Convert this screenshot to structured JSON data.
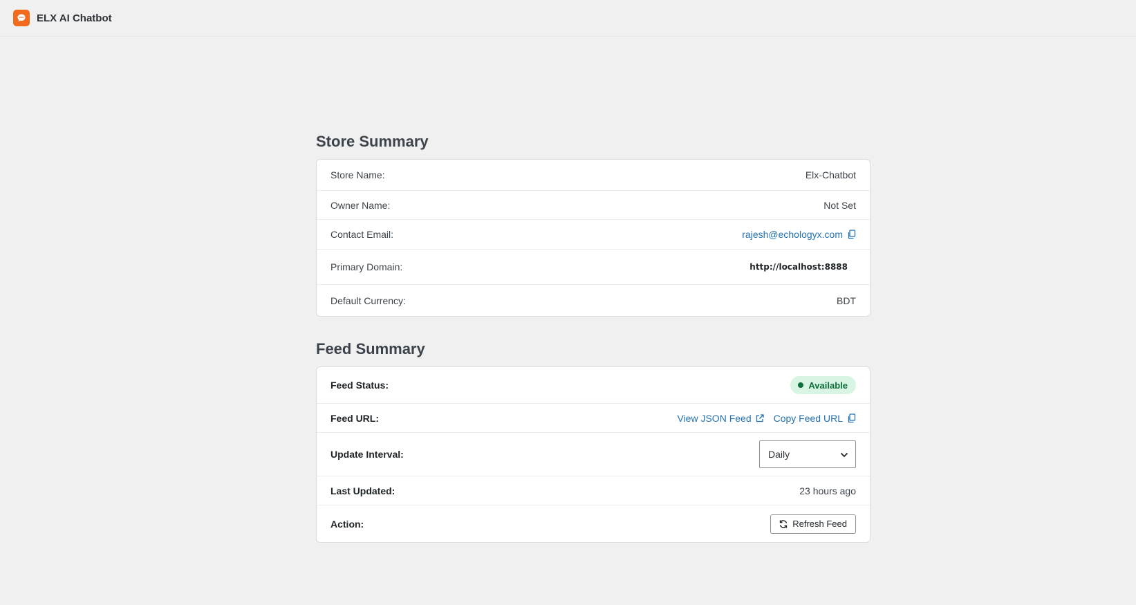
{
  "app": {
    "title": "ELX AI Chatbot"
  },
  "store_summary": {
    "heading": "Store Summary",
    "rows": [
      {
        "label": "Store Name:",
        "value": "Elx-Chatbot"
      },
      {
        "label": "Owner Name:",
        "value": "Not Set"
      },
      {
        "label": "Contact Email:",
        "value": "rajesh@echologyx.com"
      },
      {
        "label": "Primary Domain:",
        "value": "http://localhost:8888"
      },
      {
        "label": "Default Currency:",
        "value": "BDT"
      }
    ]
  },
  "feed_summary": {
    "heading": "Feed Summary",
    "status": {
      "label": "Feed Status:",
      "value": "Available"
    },
    "url": {
      "label": "Feed URL:",
      "view_link": "View JSON Feed",
      "copy_link": "Copy Feed URL"
    },
    "interval": {
      "label": "Update Interval:",
      "selected": "Daily"
    },
    "last_updated": {
      "label": "Last Updated:",
      "value": "23 hours ago"
    },
    "action": {
      "label": "Action:",
      "button": "Refresh Feed"
    }
  },
  "colors": {
    "accent_orange": "#f26a1b",
    "link_blue": "#2271b1",
    "status_green_bg": "#d7f5e2",
    "status_green_text": "#0d6e3a",
    "page_bg": "#f0f0f1"
  },
  "icons": {
    "logo": "chat-bubble-icon",
    "copy": "copy-icon",
    "external": "external-link-icon",
    "chevron": "chevron-down-icon",
    "refresh": "refresh-icon"
  }
}
